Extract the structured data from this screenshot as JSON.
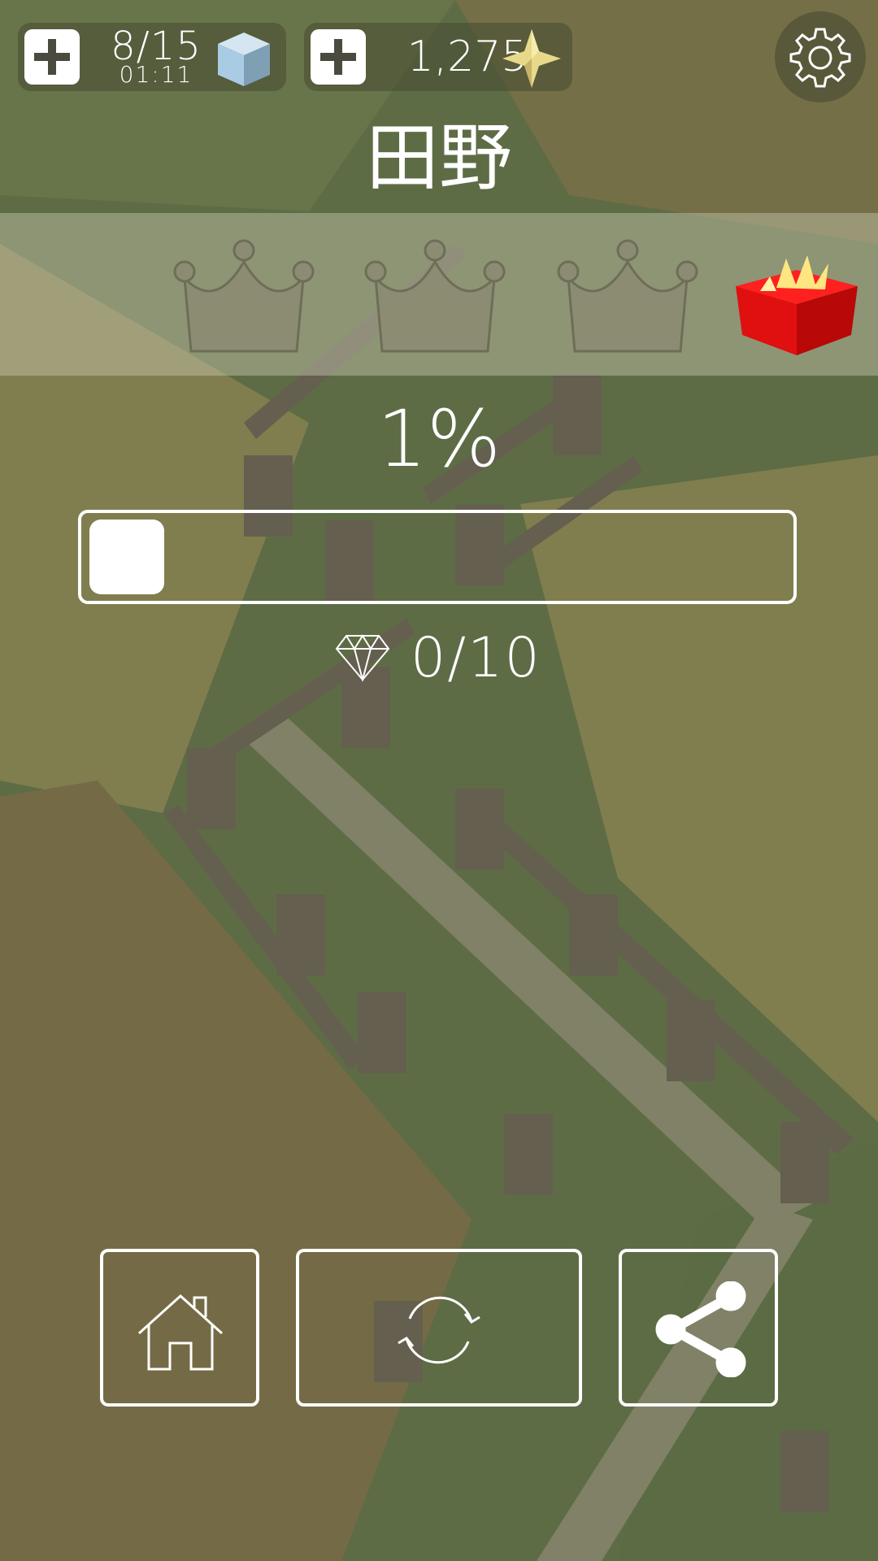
{
  "hud": {
    "lives_count": "8/15",
    "lives_timer": "01:11",
    "lives_icon": "blue-cube-icon",
    "coins": "1,275",
    "coins_icon": "gold-star-icon",
    "settings_icon": "gear-icon"
  },
  "level": {
    "title": "田野",
    "progress_percent_label": "1%",
    "progress_value": 0.01,
    "gems_label": "0/10",
    "crowns_total": 3,
    "crowns_earned": 0
  },
  "buttons": {
    "home_icon": "home-icon",
    "restart_icon": "restart-icon",
    "share_icon": "share-icon"
  },
  "colors": {
    "grass": "#5f6f45",
    "field": "#7a6f45",
    "fence": "#6e6358",
    "gift_red": "#e01010"
  }
}
